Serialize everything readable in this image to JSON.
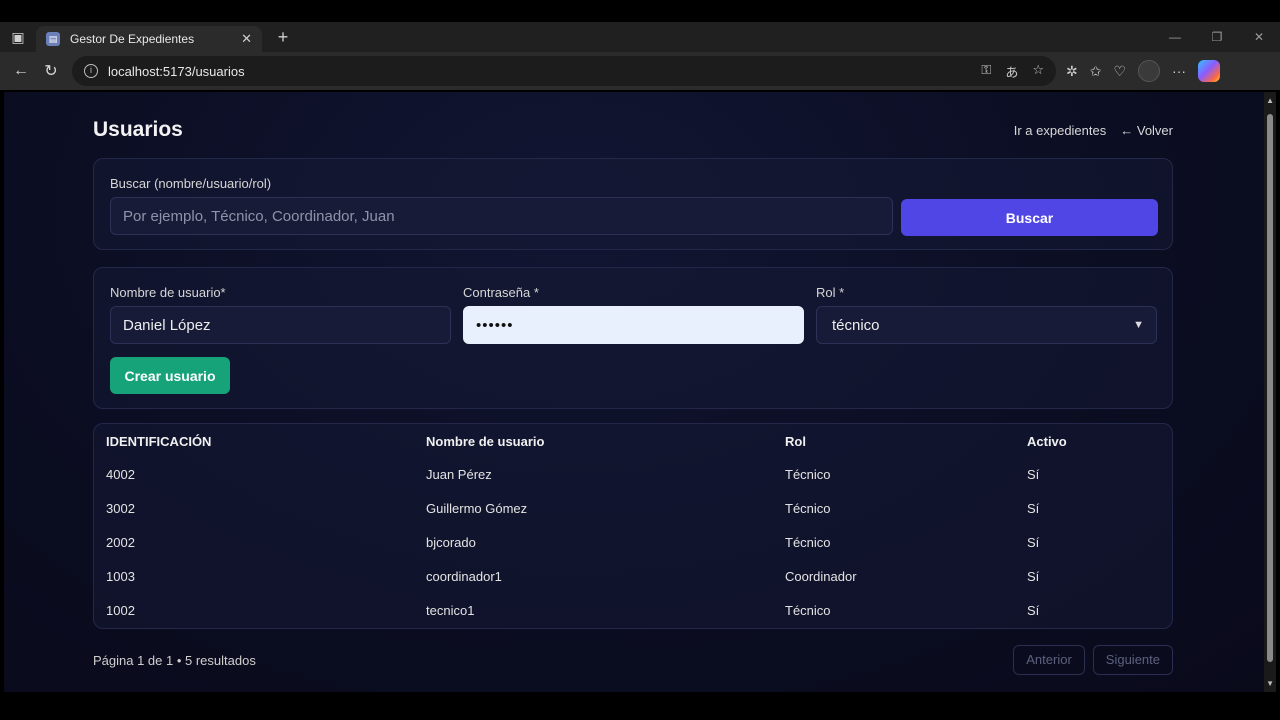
{
  "browser": {
    "tab_title": "Gestor De Expedientes",
    "url": "localhost:5173/usuarios"
  },
  "page": {
    "title": "Usuarios",
    "links": {
      "expedientes": "Ir a expedientes",
      "volver": "← Volver"
    }
  },
  "search": {
    "label": "Buscar (nombre/usuario/rol)",
    "placeholder": "Por ejemplo, Técnico, Coordinador, Juan",
    "value": "",
    "button": "Buscar"
  },
  "create_form": {
    "username_label": "Nombre de usuario*",
    "username_value": "Daniel López",
    "password_label": "Contraseña *",
    "password_value": "••••••",
    "role_label": "Rol *",
    "role_value": "técnico",
    "submit": "Crear usuario"
  },
  "table": {
    "headers": [
      "IDENTIFICACIÓN",
      "Nombre de usuario",
      "Rol",
      "Activo"
    ],
    "rows": [
      [
        "4002",
        "Juan Pérez",
        "Técnico",
        "Sí"
      ],
      [
        "3002",
        "Guillermo Gómez",
        "Técnico",
        "Sí"
      ],
      [
        "2002",
        "bjcorado",
        "Técnico",
        "Sí"
      ],
      [
        "1003",
        "coordinador1",
        "Coordinador",
        "Sí"
      ],
      [
        "1002",
        "tecnico1",
        "Técnico",
        "Sí"
      ]
    ]
  },
  "pagination": {
    "info": "Página 1 de 1 • 5 resultados",
    "prev": "Anterior",
    "next": "Siguiente"
  },
  "colors": {
    "primary": "#5046e5",
    "success": "#16a37a",
    "background": "#0b0d22"
  }
}
